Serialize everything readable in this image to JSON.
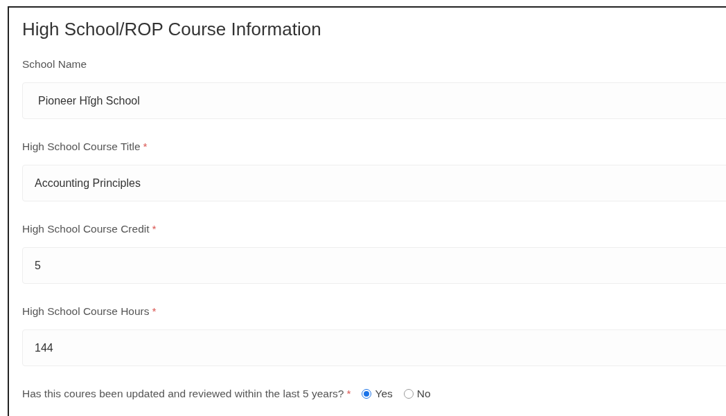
{
  "title": "High School/ROP Course Information",
  "fields": [
    {
      "label": "School Name",
      "required": false,
      "value": "Pioneer Hĭgh School"
    },
    {
      "label": "High School Course Title",
      "required": true,
      "value": "Accounting Principles"
    },
    {
      "label": "High School Course Credit",
      "required": true,
      "value": "5"
    },
    {
      "label": "High School Course Hours",
      "required": true,
      "value": "144"
    }
  ],
  "question": {
    "label": "Has this coures been updated and reviewed within the last 5 years?",
    "required": true,
    "required_mark": "*",
    "options": [
      {
        "label": "Yes",
        "selected": true
      },
      {
        "label": "No",
        "selected": false
      }
    ]
  }
}
